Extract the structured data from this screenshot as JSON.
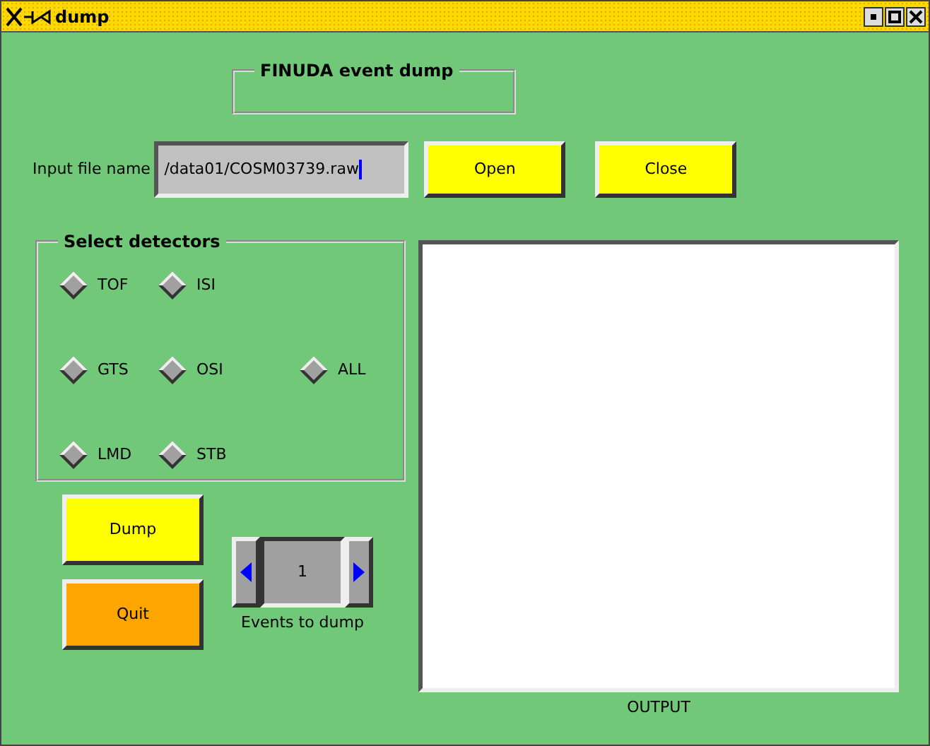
{
  "window": {
    "title": "dump"
  },
  "header_frame": {
    "title": "FINUDA event dump"
  },
  "input": {
    "label": "Input file name",
    "value": "/data01/COSM03739.raw"
  },
  "file_buttons": [
    {
      "label": "Open",
      "color": "#ffff00"
    },
    {
      "label": "Close",
      "color": "#ffff00"
    }
  ],
  "detectors": {
    "title": "Select detectors",
    "items": [
      {
        "label": "TOF",
        "checked": false
      },
      {
        "label": "ISI",
        "checked": false
      },
      {
        "label": "GTS",
        "checked": false
      },
      {
        "label": "OSI",
        "checked": false
      },
      {
        "label": "LMD",
        "checked": false
      },
      {
        "label": "STB",
        "checked": false
      }
    ],
    "all": {
      "label": "ALL",
      "checked": false
    }
  },
  "action_buttons": [
    {
      "label": "Dump",
      "color": "#ffff00"
    },
    {
      "label": "Quit",
      "color": "#ffa500"
    }
  ],
  "events": {
    "value": "1",
    "label": "Events to dump"
  },
  "output": {
    "label": "OUTPUT"
  }
}
